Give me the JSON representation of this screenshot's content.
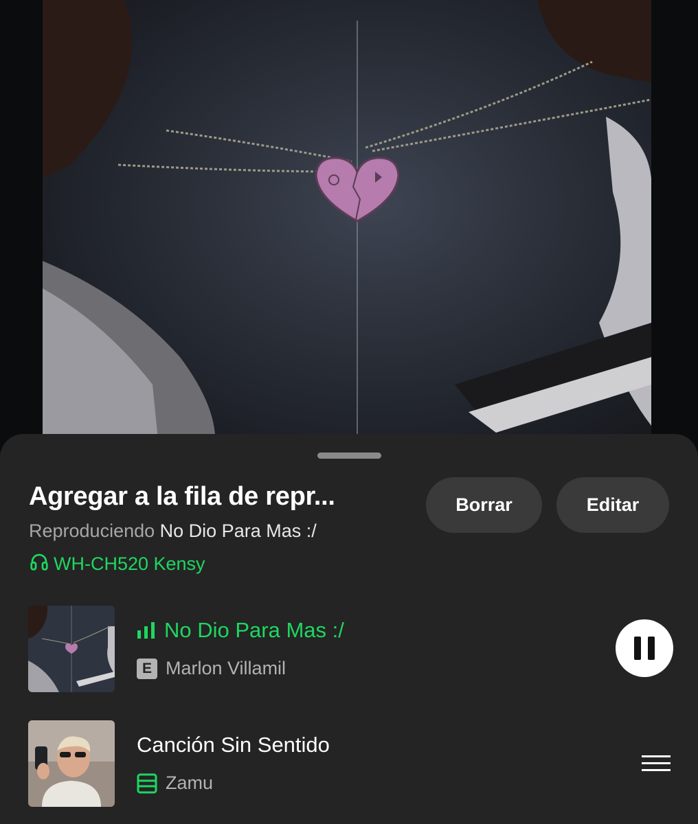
{
  "sheet": {
    "title": "Agregar a la fila de repr...",
    "now_playing_prefix": "Reproduciendo",
    "now_playing_track": "No Dio Para Mas :/",
    "device_name": "WH-CH520 Kensy",
    "delete_label": "Borrar",
    "edit_label": "Editar"
  },
  "queue": [
    {
      "title": "No Dio Para Mas :/",
      "artist": "Marlon Villamil",
      "explicit_label": "E",
      "state": "playing",
      "icon": "equalizer-icon"
    },
    {
      "title": "Canción Sin Sentido",
      "artist": "Zamu",
      "state": "queued",
      "icon": "playlist-icon"
    }
  ],
  "colors": {
    "accent": "#1ed760",
    "sheet_bg": "#242424",
    "pill_bg": "#3a3a3a",
    "text_secondary": "#b3b3b3"
  }
}
